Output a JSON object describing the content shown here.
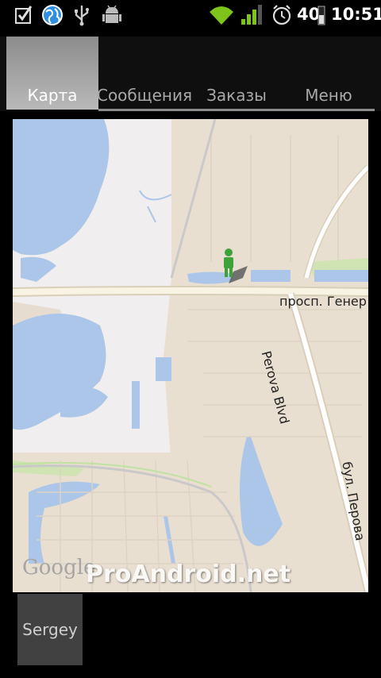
{
  "statusbar": {
    "battery": "40",
    "time": "10:51",
    "icons": [
      "checkbox-notification-icon",
      "globe-icon",
      "usb-icon",
      "android-debug-icon",
      "wifi-icon",
      "signal-icon",
      "alarm-icon",
      "battery-icon"
    ]
  },
  "tabs": [
    {
      "label": "Карта",
      "active": true
    },
    {
      "label": "Сообщения",
      "active": false
    },
    {
      "label": "Заказы",
      "active": false
    },
    {
      "label": "Меню",
      "active": false
    }
  ],
  "map": {
    "street_1": "просп. Генер",
    "street_2": "Perova Blvd",
    "street_3": "бул. Перова",
    "provider": "Google",
    "watermark": "ProAndroid.net",
    "colors": {
      "water": "#abc6e8",
      "land": "#f1eeef",
      "urban": "#e9dfd0",
      "road": "#ffffff",
      "park": "#cfe3b3"
    }
  },
  "user": {
    "name": "Sergey"
  }
}
